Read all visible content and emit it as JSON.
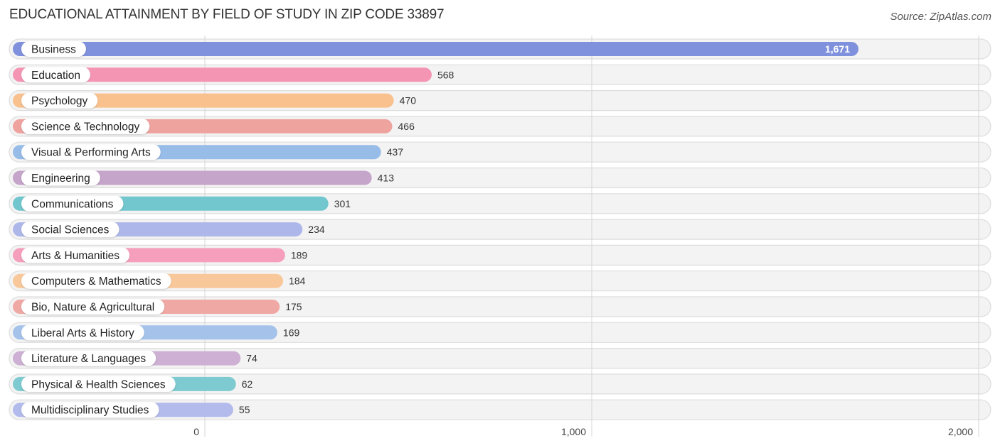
{
  "chart_data": {
    "type": "bar",
    "orientation": "horizontal",
    "title": "EDUCATIONAL ATTAINMENT BY FIELD OF STUDY IN ZIP CODE 33897",
    "source": "Source: ZipAtlas.com",
    "xlabel": "",
    "ylabel": "",
    "xlim": [
      0,
      2000
    ],
    "xticks": [
      0,
      1000,
      2000
    ],
    "xtick_labels": [
      "0",
      "1,000",
      "2,000"
    ],
    "grid": true,
    "categories": [
      "Business",
      "Education",
      "Psychology",
      "Science & Technology",
      "Visual & Performing Arts",
      "Engineering",
      "Communications",
      "Social Sciences",
      "Arts & Humanities",
      "Computers & Mathematics",
      "Bio, Nature & Agricultural",
      "Liberal Arts & History",
      "Literature & Languages",
      "Physical & Health Sciences",
      "Multidisciplinary Studies"
    ],
    "values": [
      1671,
      568,
      470,
      466,
      437,
      413,
      301,
      234,
      189,
      184,
      175,
      169,
      74,
      62,
      55
    ],
    "value_labels": [
      "1,671",
      "568",
      "470",
      "466",
      "437",
      "413",
      "301",
      "234",
      "189",
      "184",
      "175",
      "169",
      "74",
      "62",
      "55"
    ],
    "colors": [
      "#7f91dc",
      "#f595b4",
      "#f9c18e",
      "#eea39f",
      "#97bce8",
      "#c5a5ca",
      "#72c6cd",
      "#aeb7e9",
      "#f59fbd",
      "#f9c89a",
      "#f0a8a4",
      "#a5c3ea",
      "#cdb0d3",
      "#7dcad0",
      "#b3bbec"
    ]
  }
}
